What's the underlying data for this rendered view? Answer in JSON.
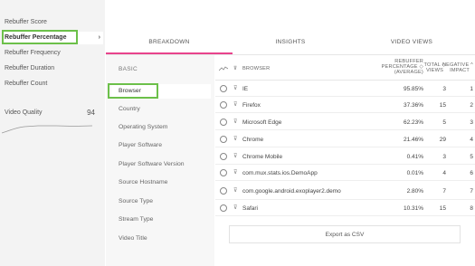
{
  "sidebar": {
    "items": [
      {
        "label": "Rebuffer Score"
      },
      {
        "label": "Rebuffer Percentage",
        "chevron": "›"
      },
      {
        "label": "Rebuffer Frequency"
      },
      {
        "label": "Rebuffer Duration"
      },
      {
        "label": "Rebuffer Count"
      }
    ],
    "video_quality": {
      "label": "Video Quality",
      "value": "94"
    }
  },
  "tabs": {
    "breakdown": "BREAKDOWN",
    "insights": "INSIGHTS",
    "video_views": "VIDEO VIEWS"
  },
  "dimensions": {
    "header": "BASIC",
    "items": [
      {
        "label": "Browser"
      },
      {
        "label": "Country"
      },
      {
        "label": "Operating System"
      },
      {
        "label": "Player Software"
      },
      {
        "label": "Player Software Version"
      },
      {
        "label": "Source Hostname"
      },
      {
        "label": "Source Type"
      },
      {
        "label": "Stream Type"
      },
      {
        "label": "Video Title"
      }
    ]
  },
  "table": {
    "headers": {
      "filter_icon": "⊽",
      "browser": "BROWSER",
      "pct_line1": "REBUFFER",
      "pct_line2": "PERCENTAGE ◇",
      "pct_line3": "(AVERAGE)",
      "views_line1": "TOTAL ◇",
      "views_line2": "VIEWS",
      "impact_line1": "NEGATIVE ^",
      "impact_line2": "IMPACT"
    },
    "rows": [
      {
        "name": "IE",
        "pct": "95.85%",
        "views": "3",
        "impact": "1"
      },
      {
        "name": "Firefox",
        "pct": "37.36%",
        "views": "15",
        "impact": "2"
      },
      {
        "name": "Microsoft Edge",
        "pct": "62.23%",
        "views": "5",
        "impact": "3"
      },
      {
        "name": "Chrome",
        "pct": "21.46%",
        "views": "29",
        "impact": "4"
      },
      {
        "name": "Chrome Mobile",
        "pct": "0.41%",
        "views": "3",
        "impact": "5"
      },
      {
        "name": "com.mux.stats.ios.DemoApp",
        "pct": "0.01%",
        "views": "4",
        "impact": "6"
      },
      {
        "name": "com.google.android.exoplayer2.demo",
        "pct": "2.80%",
        "views": "7",
        "impact": "7"
      },
      {
        "name": "Safari",
        "pct": "10.31%",
        "views": "15",
        "impact": "8"
      }
    ],
    "export_label": "Export as CSV"
  },
  "colors": {
    "accent": "#e8438c",
    "highlight": "#6cc04a"
  }
}
